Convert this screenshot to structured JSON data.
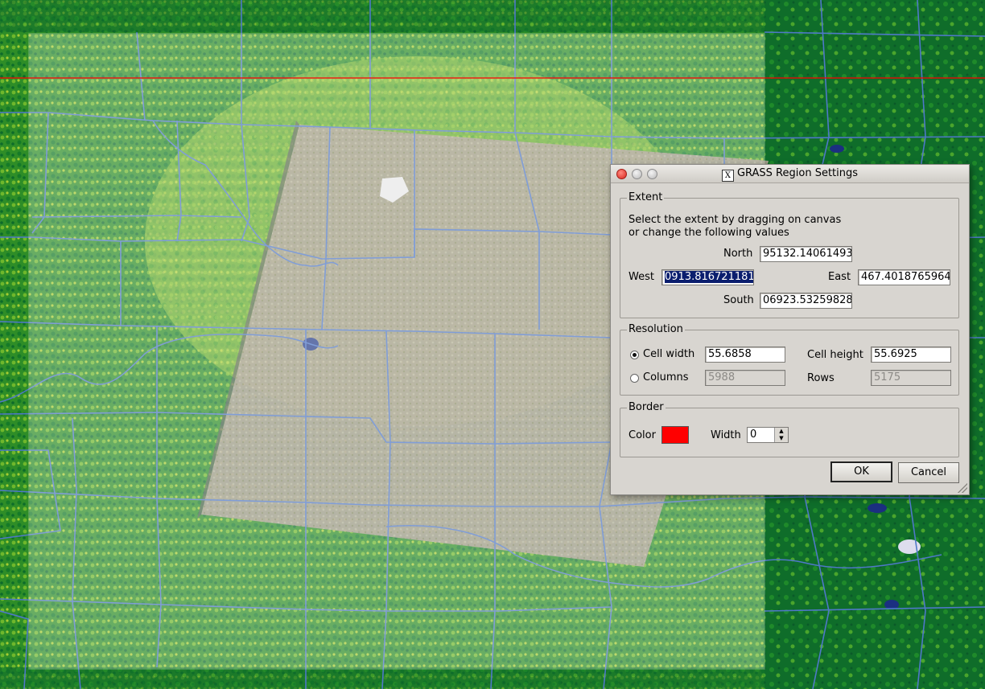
{
  "window": {
    "title": "GRASS Region Settings",
    "title_icon": "x11-icon"
  },
  "extent": {
    "legend": "Extent",
    "instructions_line1": "Select the extent by dragging on canvas",
    "instructions_line2": "or change the following values",
    "north_label": "North",
    "north_value": "95132.14061493",
    "west_label": "West",
    "west_value": "0913.816721181",
    "east_label": "East",
    "east_value": "467.4018765964",
    "south_label": "South",
    "south_value": "06923.53259828"
  },
  "resolution": {
    "legend": "Resolution",
    "cell_width_label": "Cell width",
    "cell_width_value": "55.6858",
    "cell_height_label": "Cell height",
    "cell_height_value": "55.6925",
    "columns_label": "Columns",
    "columns_value": "5988",
    "rows_label": "Rows",
    "rows_value": "5175",
    "selected_mode": "Cell width"
  },
  "border": {
    "legend": "Border",
    "color_label": "Color",
    "color_value": "#ff0000",
    "width_label": "Width",
    "width_value": "0"
  },
  "buttons": {
    "ok": "OK",
    "cancel": "Cancel"
  },
  "map": {
    "boundary_color": "#4f78c8",
    "border_line_color": "#ff0000",
    "overlay_color": "#ffffff"
  }
}
